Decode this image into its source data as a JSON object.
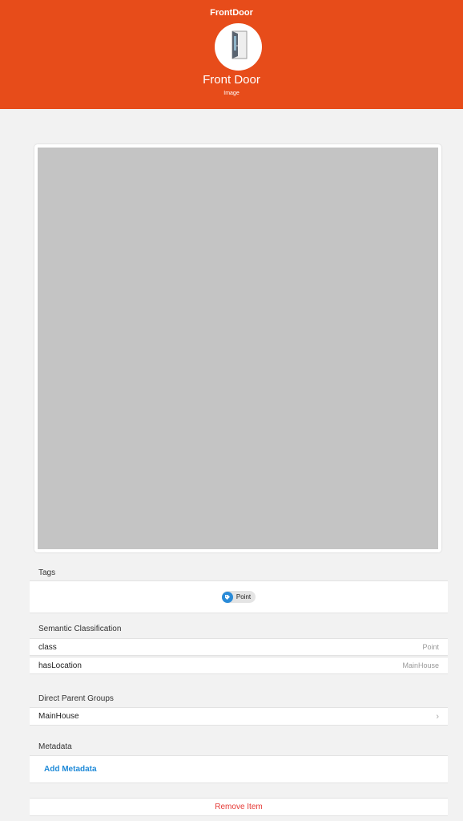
{
  "header": {
    "title": "FrontDoor",
    "name": "Front Door",
    "subtitle": "Image",
    "icon": "door-icon",
    "background_color": "#e74c1a"
  },
  "tags": {
    "header": "Tags",
    "items": [
      {
        "label": "Point",
        "icon": "tag-icon",
        "color": "#2a8bd8"
      }
    ]
  },
  "semantic": {
    "header": "Semantic Classification",
    "rows": [
      {
        "label": "class",
        "value": "Point"
      },
      {
        "label": "hasLocation",
        "value": "MainHouse"
      }
    ]
  },
  "parents": {
    "header": "Direct Parent Groups",
    "items": [
      {
        "label": "MainHouse"
      }
    ]
  },
  "metadata": {
    "header": "Metadata",
    "add_label": "Add Metadata",
    "accent_color": "#1f8ad8"
  },
  "remove": {
    "label": "Remove Item",
    "color": "#e53935"
  }
}
